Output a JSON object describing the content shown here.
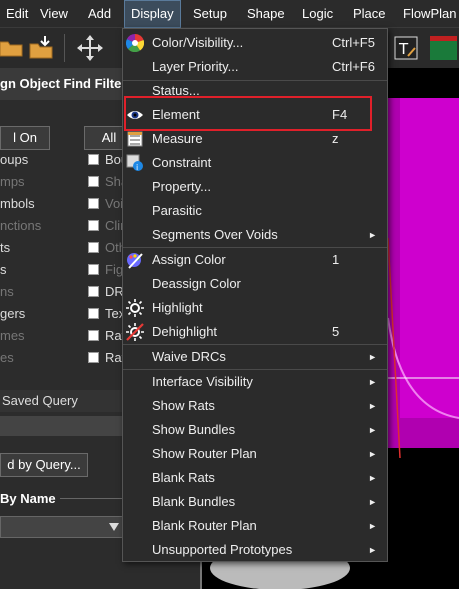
{
  "menubar": {
    "items": [
      {
        "label": "Edit"
      },
      {
        "label": "View"
      },
      {
        "label": "Add"
      },
      {
        "label": "Display"
      },
      {
        "label": "Setup"
      },
      {
        "label": "Shape"
      },
      {
        "label": "Logic"
      },
      {
        "label": "Place"
      },
      {
        "label": "FlowPlan"
      }
    ]
  },
  "panel": {
    "title": "gn Object Find Filter",
    "on_button": "l On",
    "all_button": "All",
    "left_items": [
      "oups",
      "mps",
      "mbols",
      "nctions",
      "ts",
      "s",
      "ns",
      "gers",
      "mes",
      "es"
    ],
    "right_items": [
      "Bou",
      "Sha",
      "Voi",
      "Clin",
      "Oth",
      "Fig",
      "DR",
      "Tex",
      "Rat",
      "Rat"
    ],
    "saved_query": "Saved Query",
    "find_by_query_button": "d by Query...",
    "by_name_label": "By Name"
  },
  "menu": {
    "items": [
      {
        "label": "Color/Visibility...",
        "shortcut": "Ctrl+F5",
        "icon": "color-wheel-icon"
      },
      {
        "label": "Layer Priority...",
        "shortcut": "Ctrl+F6"
      },
      {
        "label": "Status..."
      },
      {
        "label": "Element",
        "shortcut": "F4",
        "icon": "eye-icon"
      },
      {
        "label": "Measure",
        "shortcut": "z",
        "icon": "measure-icon"
      },
      {
        "label": "Constraint",
        "icon": "constraint-icon"
      },
      {
        "label": "Property..."
      },
      {
        "label": "Parasitic"
      },
      {
        "label": "Segments Over Voids",
        "submenu": true
      },
      {
        "label": "Assign Color",
        "shortcut": "1",
        "icon": "paint-icon"
      },
      {
        "label": "Deassign Color"
      },
      {
        "label": "Highlight",
        "icon": "highlight-sun-icon"
      },
      {
        "label": "Dehighlight",
        "shortcut": "5",
        "icon": "dehighlight-sun-icon"
      },
      {
        "label": "Waive DRCs",
        "submenu": true
      },
      {
        "label": "Interface Visibility",
        "submenu": true
      },
      {
        "label": "Show Rats",
        "submenu": true
      },
      {
        "label": "Show Bundles",
        "submenu": true
      },
      {
        "label": "Show Router Plan",
        "submenu": true
      },
      {
        "label": "Blank Rats",
        "submenu": true
      },
      {
        "label": "Blank Bundles",
        "submenu": true
      },
      {
        "label": "Blank Router Plan",
        "submenu": true
      },
      {
        "label": "Unsupported Prototypes",
        "submenu": true
      }
    ],
    "arrow": "►"
  },
  "colors": {
    "magenta": "#d400d4",
    "highlight_box": "#e0202a"
  }
}
